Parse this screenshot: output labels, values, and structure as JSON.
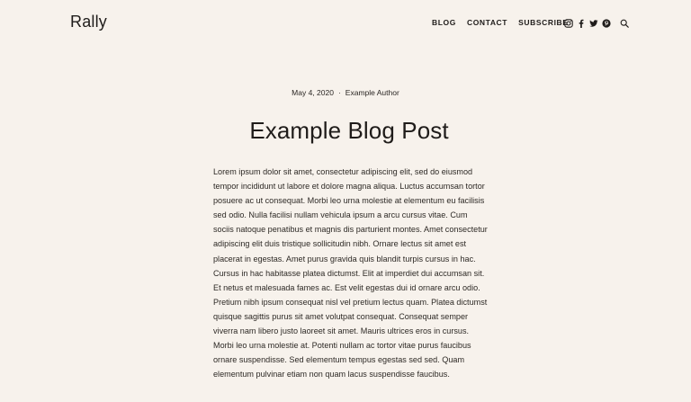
{
  "site": {
    "logo": "Rally"
  },
  "nav": {
    "items": [
      {
        "label": "BLOG"
      },
      {
        "label": "CONTACT"
      },
      {
        "label": "SUBSCRIBE"
      }
    ]
  },
  "social": {
    "icons": [
      "instagram-icon",
      "facebook-icon",
      "twitter-icon",
      "pinterest-icon"
    ],
    "search_icon": "search-icon"
  },
  "post": {
    "date": "May 4, 2020",
    "separator": "·",
    "author": "Example Author",
    "title": "Example Blog Post",
    "body": "Lorem ipsum dolor sit amet, consectetur adipiscing elit, sed do eiusmod tempor incididunt ut labore et dolore magna aliqua. Luctus accumsan tortor posuere ac ut consequat. Morbi leo urna molestie at elementum eu facilisis sed odio. Nulla facilisi nullam vehicula ipsum a arcu cursus vitae. Cum sociis natoque penatibus et magnis dis parturient montes. Amet consectetur adipiscing elit duis tristique sollicitudin nibh. Ornare lectus sit amet est placerat in egestas. Amet purus gravida quis blandit turpis cursus in hac. Cursus in hac habitasse platea dictumst. Elit at imperdiet dui accumsan sit. Et netus et malesuada fames ac. Est velit egestas dui id ornare arcu odio. Pretium nibh ipsum consequat nisl vel pretium lectus quam. Platea dictumst quisque sagittis purus sit amet volutpat consequat. Consequat semper viverra nam libero justo laoreet sit amet. Mauris ultrices eros in cursus. Morbi leo urna molestie at. Potenti nullam ac tortor vitae purus faucibus ornare suspendisse. Sed elementum tempus egestas sed sed. Quam elementum pulvinar etiam non quam lacus suspendisse faucibus."
  },
  "colors": {
    "background": "#f7f2ec",
    "text": "#2a2623"
  }
}
